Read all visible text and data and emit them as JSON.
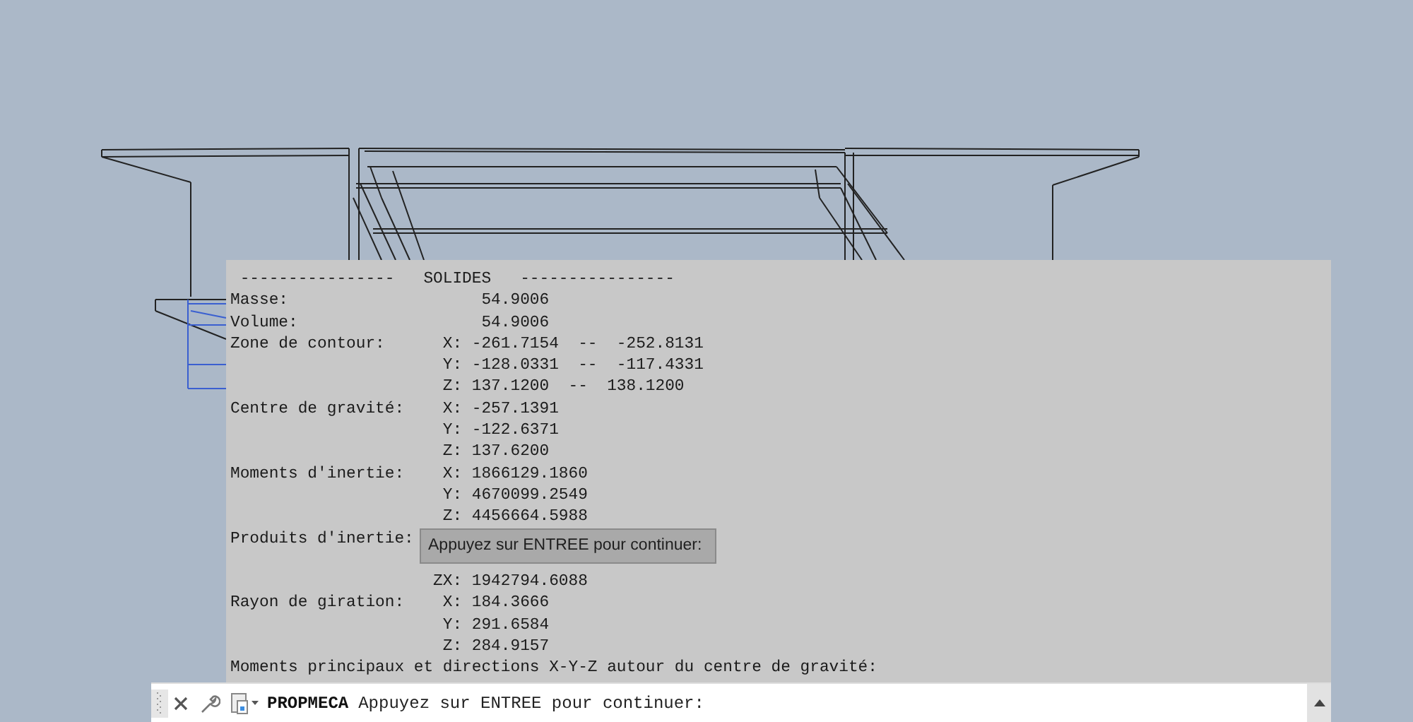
{
  "history": {
    "lines": [
      {
        "kind": "text",
        "text": " ----------------   SOLIDES   ----------------"
      },
      {
        "kind": "text",
        "text": "Masse:                    54.9006"
      },
      {
        "kind": "text",
        "text": "Volume:                   54.9006"
      },
      {
        "kind": "text",
        "text": "Zone de contour:      X: -261.7154  --  -252.8131"
      },
      {
        "kind": "text",
        "text": "                      Y: -128.0331  --  -117.4331"
      },
      {
        "kind": "text",
        "text": "                      Z: 137.1200  --  138.1200"
      },
      {
        "kind": "text",
        "text": "Centre de gravité:    X: -257.1391"
      },
      {
        "kind": "text",
        "text": "                      Y: -122.6371"
      },
      {
        "kind": "text",
        "text": "                      Z: 137.6200"
      },
      {
        "kind": "text",
        "text": "Moments d'inertie:    X: 1866129.1860"
      },
      {
        "kind": "text",
        "text": "                      Y: 4670099.2549"
      },
      {
        "kind": "text",
        "text": "                      Z: 4456664.5988"
      },
      {
        "kind": "text",
        "text": "Produits d'inertie:"
      },
      {
        "kind": "covered"
      },
      {
        "kind": "text",
        "text": "                     ZX: 1942794.6088"
      },
      {
        "kind": "text",
        "text": "Rayon de giration:    X: 184.3666"
      },
      {
        "kind": "text",
        "text": "                      Y: 291.6584"
      },
      {
        "kind": "text",
        "text": "                      Z: 284.9157"
      },
      {
        "kind": "text",
        "text": "Moments principaux et directions X-Y-Z autour du centre de gravité:"
      }
    ]
  },
  "tooltip": {
    "text": "Appuyez sur ENTREE pour continuer:"
  },
  "command_line": {
    "command": "PROPMECA",
    "prompt": "Appuyez sur ENTREE pour continuer:"
  }
}
